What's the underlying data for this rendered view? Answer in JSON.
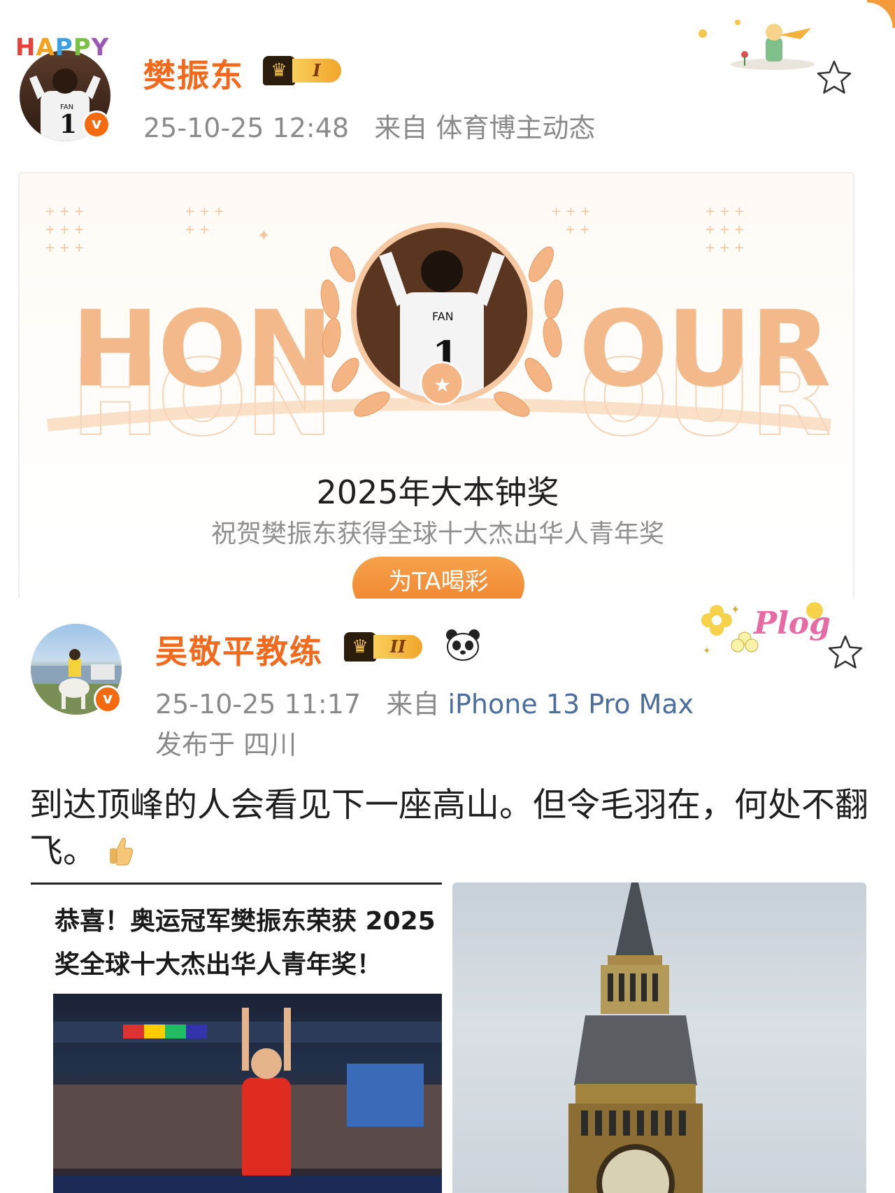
{
  "posts": [
    {
      "avatar_badge": "HAPPY",
      "username": "樊振东",
      "vip_level": "I",
      "timestamp": "25-10-25 12:48",
      "source_prefix": "来自",
      "source": "体育博主动态",
      "card": {
        "honour_left": "HON",
        "honour_right": "OUR",
        "title": "2025年大本钟奖",
        "subtitle": "祝贺樊振东获得全球十大杰出华人青年奖",
        "button": "为TA喝彩"
      }
    },
    {
      "username": "吴敬平教练",
      "vip_level": "II",
      "timestamp": "25-10-25 11:17",
      "source_prefix": "来自",
      "source": "iPhone 13 Pro Max",
      "location": "发布于 四川",
      "decoration_text": "Plog",
      "text": "到达顶峰的人会看见下一座高山。但令毛羽在，何处不翻飞。",
      "images": [
        {
          "caption": "恭喜！奥运冠军樊振东荣获 2025 奖全球十大杰出华人青年奖！"
        },
        {
          "caption": ""
        }
      ]
    }
  ],
  "colors": {
    "accent": "#f2691b",
    "link": "#4b6e9e",
    "meta": "#8a8a8a",
    "honour": "#f3b98a"
  },
  "icons": [
    "star-icon",
    "crown-icon",
    "verified-icon",
    "panda-icon",
    "thumbs-up-icon"
  ]
}
